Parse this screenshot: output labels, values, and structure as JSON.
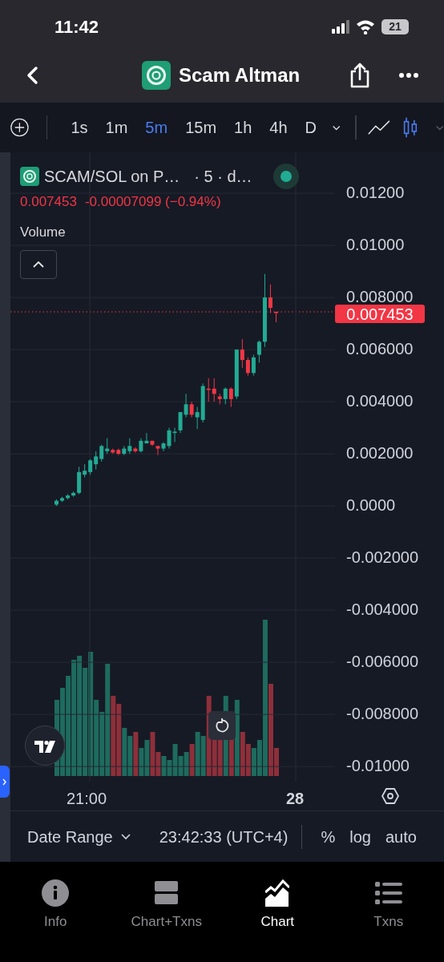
{
  "status_bar": {
    "time": "11:42",
    "battery": "21"
  },
  "header": {
    "title": "Scam Altman"
  },
  "toolbar": {
    "intervals": [
      {
        "label": "1s",
        "selected": false
      },
      {
        "label": "1m",
        "selected": false
      },
      {
        "label": "5m",
        "selected": true
      },
      {
        "label": "15m",
        "selected": false
      },
      {
        "label": "1h",
        "selected": false
      },
      {
        "label": "4h",
        "selected": false
      },
      {
        "label": "D",
        "selected": false
      }
    ],
    "chart_styles": [
      {
        "kind": "line",
        "selected": false
      },
      {
        "kind": "candles",
        "selected": true
      }
    ]
  },
  "legend": {
    "symbol": "SCAM/SOL on P…",
    "details": "· 5 · d…",
    "price": "0.007453",
    "change": "-0.00007099 (−0.94%)",
    "indicator": "Volume"
  },
  "chart_data": {
    "type": "candlestick",
    "grid": true,
    "ohlc": [
      [
        5e-05,
        0.00025,
        0,
        0.0002
      ],
      [
        0.0002,
        0.00035,
        0.00015,
        0.0003
      ],
      [
        0.0003,
        0.00045,
        0.00025,
        0.0004
      ],
      [
        0.0004,
        0.00055,
        0.00035,
        0.0005
      ],
      [
        0.0005,
        0.0015,
        0.00045,
        0.0013
      ],
      [
        0.0012,
        0.0016,
        0.0011,
        0.00135
      ],
      [
        0.0013,
        0.0018,
        0.0012,
        0.00175
      ],
      [
        0.0016,
        0.0021,
        0.0014,
        0.0019
      ],
      [
        0.0018,
        0.00235,
        0.0017,
        0.0023
      ],
      [
        0.0021,
        0.0026,
        0.002,
        0.0022
      ],
      [
        0.00215,
        0.0022,
        0.002,
        0.00205
      ],
      [
        0.00215,
        0.0022,
        0.00195,
        0.002
      ],
      [
        0.002,
        0.0023,
        0.00195,
        0.0022
      ],
      [
        0.0021,
        0.0026,
        0.002,
        0.0023
      ],
      [
        0.0022,
        0.00225,
        0.00205,
        0.0021
      ],
      [
        0.0021,
        0.0026,
        0.00205,
        0.0025
      ],
      [
        0.0024,
        0.0028,
        0.0024,
        0.0025
      ],
      [
        0.0025,
        0.0025,
        0.0023,
        0.00235
      ],
      [
        0.0023,
        0.0023,
        0.00195,
        0.0022
      ],
      [
        0.0022,
        0.00245,
        0.0021,
        0.0024
      ],
      [
        0.0023,
        0.003,
        0.0022,
        0.0029
      ],
      [
        0.0028,
        0.003,
        0.00245,
        0.00285
      ],
      [
        0.0029,
        0.0036,
        0.0028,
        0.0036
      ],
      [
        0.0035,
        0.0043,
        0.0034,
        0.0039
      ],
      [
        0.0039,
        0.004,
        0.0034,
        0.0035
      ],
      [
        0.0034,
        0.0038,
        0.00295,
        0.0036
      ],
      [
        0.0033,
        0.0047,
        0.0032,
        0.0046
      ],
      [
        0.0045,
        0.0049,
        0.004,
        0.00445
      ],
      [
        0.0045,
        0.0049,
        0.004,
        0.0043
      ],
      [
        0.0042,
        0.0043,
        0.0039,
        0.0041
      ],
      [
        0.0041,
        0.00455,
        0.0039,
        0.0045
      ],
      [
        0.0045,
        0.00455,
        0.0038,
        0.0041
      ],
      [
        0.0042,
        0.006,
        0.0041,
        0.006
      ],
      [
        0.006,
        0.0064,
        0.0053,
        0.0056
      ],
      [
        0.0056,
        0.0057,
        0.005,
        0.0051
      ],
      [
        0.0051,
        0.0058,
        0.005,
        0.0057
      ],
      [
        0.0058,
        0.00635,
        0.0055,
        0.0063
      ],
      [
        0.0063,
        0.0089,
        0.0061,
        0.008
      ],
      [
        0.008,
        0.0085,
        0.0074,
        0.0076
      ],
      [
        0.00745,
        0.00745,
        0.00705,
        0.0074
      ]
    ],
    "ylim": [
      -0.01058,
      0.01357
    ],
    "yticks": [
      {
        "value": 0.012,
        "label": "0.01200"
      },
      {
        "value": 0.01,
        "label": "0.01000"
      },
      {
        "value": 0.008,
        "label": "0.008000"
      },
      {
        "value": 0.006,
        "label": "0.006000"
      },
      {
        "value": 0.004,
        "label": "0.004000"
      },
      {
        "value": 0.002,
        "label": "0.002000"
      },
      {
        "value": 0,
        "label": "0.0000"
      },
      {
        "value": -0.002,
        "label": "-0.002000"
      },
      {
        "value": -0.004,
        "label": "-0.004000"
      },
      {
        "value": -0.006,
        "label": "-0.006000"
      },
      {
        "value": -0.008,
        "label": "-0.008000"
      },
      {
        "value": -0.01,
        "label": "-0.01000"
      }
    ]
  },
  "last_price": "0.007453",
  "x_axis": [
    {
      "label": "21:00",
      "bold": false
    },
    {
      "label": "28",
      "bold": true
    }
  ],
  "footer": {
    "date_range": "Date Range",
    "time": "23:42:33 (UTC+4)",
    "options": [
      "%",
      "log",
      "auto"
    ]
  },
  "tabs": [
    {
      "label": "Info",
      "kind": "info",
      "selected": false
    },
    {
      "label": "Chart+Txns",
      "kind": "split",
      "selected": false
    },
    {
      "label": "Chart",
      "kind": "chart",
      "selected": true
    },
    {
      "label": "Txns",
      "kind": "list",
      "selected": false
    }
  ]
}
